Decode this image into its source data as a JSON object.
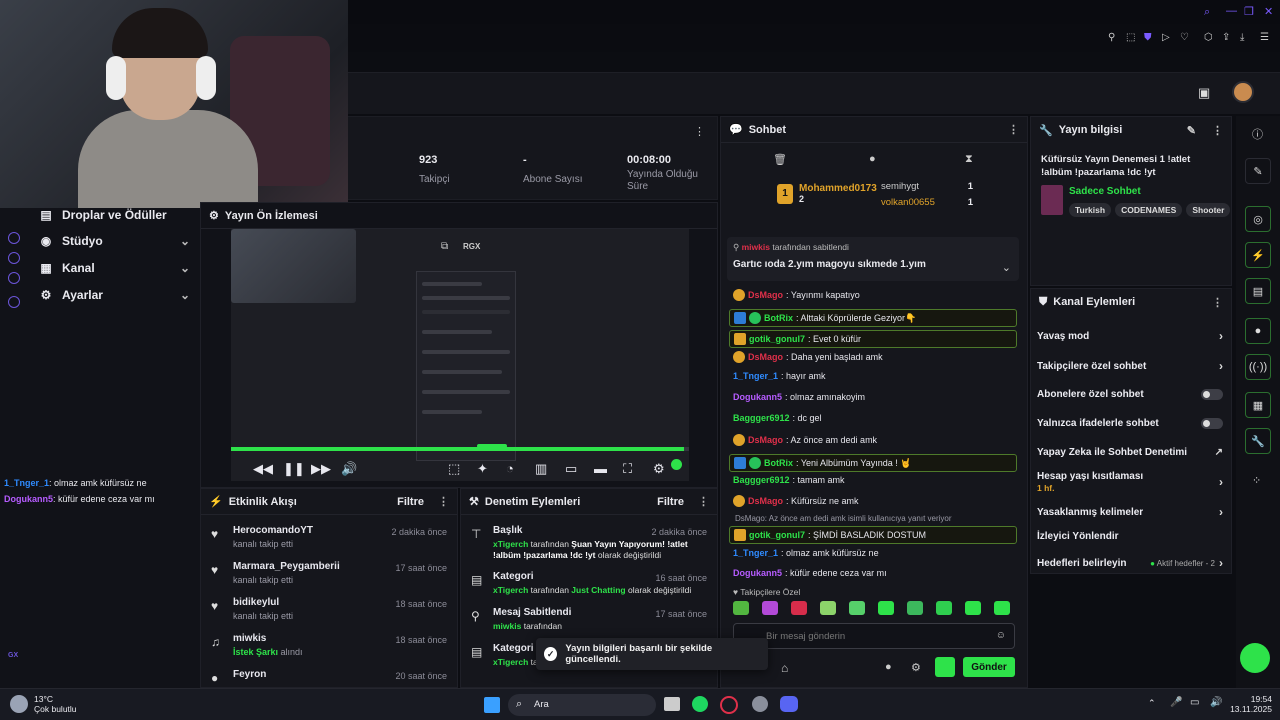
{
  "stats": [
    {
      "value": "923",
      "label": "Takipçi"
    },
    {
      "value": "-",
      "label": "Abone Sayısı"
    },
    {
      "value": "00:08:00",
      "label": "Yayında Olduğu Süre"
    }
  ],
  "nav": {
    "drops": "Droplar ve Ödüller",
    "studio": "Stüdyo",
    "channel": "Kanal",
    "settings": "Ayarlar"
  },
  "left_chat": [
    {
      "user": "1_Tnger_1",
      "text": ": olmaz amk küfürsüz ne",
      "color": "#2f8bff"
    },
    {
      "user": "Dogukann5",
      "text": ": küfür edene ceza var mı",
      "color": "#b65cff"
    }
  ],
  "rail_label": "GX",
  "preview": {
    "title": "Yayın Ön İzlemesi",
    "rgx": "RGX",
    "progress": 0.99
  },
  "activity": {
    "title": "Etkinlik Akışı",
    "filter": "Filtre",
    "items": [
      {
        "name": "HerocomandoYT",
        "sub": "kanalı takip etti",
        "time": "2 dakika önce"
      },
      {
        "name": "Marmara_Peygamberii",
        "sub": "kanalı takip etti",
        "time": "17 saat önce"
      },
      {
        "name": "bidikeylul",
        "sub": "kanalı takip etti",
        "time": "18 saat önce"
      },
      {
        "name": "miwkis",
        "sub_hl": "İstek Şarkı",
        "sub": " alındı",
        "time": "18 saat önce"
      },
      {
        "name": "Feyron",
        "sub": "",
        "time": "20 saat önce"
      }
    ]
  },
  "moderation": {
    "title": "Denetim Eylemleri",
    "filter": "Filtre",
    "items": [
      {
        "name": "Başlık",
        "time": "2 dakika önce",
        "user": "xTigerch",
        "mid": " tarafından ",
        "hl": "Şuan Yayın Yapıyorum! !atlet !albüm !pazarlama !dc !yt",
        "tail": " olarak değiştirildi"
      },
      {
        "name": "Kategori",
        "time": "16 saat önce",
        "user": "xTigerch",
        "mid": " tarafından ",
        "hl": "Just Chatting",
        "tail": " olarak değiştirildi"
      },
      {
        "name": "Mesaj Sabitlendi",
        "time": "17 saat önce",
        "user": "miwkis",
        "mid": " tarafından",
        "hl": "",
        "tail": ""
      },
      {
        "name": "Kategori",
        "time": "",
        "user": "xTigerch",
        "mid": " tarafından",
        "hl": "",
        "tail": ""
      }
    ]
  },
  "chat": {
    "title": "Sohbet",
    "leaders": [
      {
        "rank": "1",
        "name": "Mohammed0173",
        "count": "2"
      },
      {
        "rank": "",
        "name": "semihygt",
        "count": "1"
      },
      {
        "rank": "",
        "name": "volkan00655",
        "count": "1"
      }
    ],
    "pinned_by_user": "miwkis",
    "pinned_by_text": "tarafından sabitlendi",
    "pinned_msg": "Gartıc ıoda 2.yım magoyu sıkmede 1.yım",
    "messages": [
      {
        "user": "DsMago",
        "text": ": Yayınmı kapatıyo",
        "color": "#e0304a",
        "hl": false
      },
      {
        "user": "BotRix",
        "text": ": Alttaki Köprülerde Geziyor👇",
        "color": "#2ee24a",
        "hl": true
      },
      {
        "user": "gotik_gonul7",
        "text": ": Evet 0 küfür",
        "color": "#2ee24a",
        "hl": true
      },
      {
        "user": "DsMago",
        "text": ": Daha yeni başladı amk",
        "color": "#e0304a",
        "hl": false
      },
      {
        "user": "1_Tnger_1",
        "text": ": hayır amk",
        "color": "#2f8bff",
        "hl": false
      },
      {
        "user": "Dogukann5",
        "text": ": olmaz amınakoyim",
        "color": "#b65cff",
        "hl": false
      },
      {
        "user": "Baggger6912",
        "text": ": dc gel",
        "color": "#2ee24a",
        "hl": false
      },
      {
        "user": "DsMago",
        "text": ": Az önce am dedi amk",
        "color": "#e0304a",
        "hl": false
      },
      {
        "user": "BotRix",
        "text": ": Yeni Albümüm Yayında ! 🤘",
        "color": "#2ee24a",
        "hl": true
      },
      {
        "user": "Baggger6912",
        "text": ": tamam amk",
        "color": "#2ee24a",
        "hl": false
      },
      {
        "user": "DsMago",
        "text": ": Küfürsüz ne amk",
        "color": "#e0304a",
        "hl": false
      },
      {
        "user": "gotik_gonul7",
        "text": ": ŞİMDİ BASLADIK DOSTUM",
        "color": "#2ee24a",
        "hl": true,
        "reply": "DsMago: Az önce am dedi amk isimli kullanıcıya yanıt veriyor"
      },
      {
        "user": "1_Tnger_1",
        "text": ": olmaz amk küfürsüz ne",
        "color": "#2f8bff",
        "hl": false
      },
      {
        "user": "Dogukann5",
        "text": ": küfür edene ceza var mı",
        "color": "#b65cff",
        "hl": false
      }
    ],
    "emote_section": "Takipçilere Özel",
    "input_placeholder": "Bir mesaj gönderin",
    "send": "Gönder"
  },
  "info": {
    "title": "Yayın bilgisi",
    "stream_title": "Küfürsüz Yayın Denemesi 1 !atlet !albüm !pazarlama !dc !yt",
    "category": "Sadece Sohbet",
    "tags": [
      "Turkish",
      "CODENAMES",
      "Shooter"
    ]
  },
  "actions": {
    "title": "Kanal Eylemleri",
    "slow": "Yavaş mod",
    "followers": "Takipçilere özel sohbet",
    "subs": "Abonelere özel sohbet",
    "emotes": "Yalnızca ifadelerle sohbet",
    "ai": "Yapay Zeka ile Sohbet Denetimi",
    "age": "Hesap yaşı kısıtlaması",
    "age_val": "1 hf.",
    "banned": "Yasaklanmış kelimeler",
    "raid": "İzleyici Yönlendir",
    "goals": "Hedefleri belirleyin",
    "goals_status": "Aktif hedefler - 2"
  },
  "toast": "Yayın bilgileri başarılı bir şekilde güncellendi.",
  "taskbar": {
    "temp": "13°C",
    "weather": "Çok bulutlu",
    "search": "Ara",
    "time": "19:54",
    "date": "13.11.2025"
  },
  "colors": {
    "accent": "#2ee24a",
    "purple": "#6b55d9",
    "gold": "#e0a32a"
  }
}
